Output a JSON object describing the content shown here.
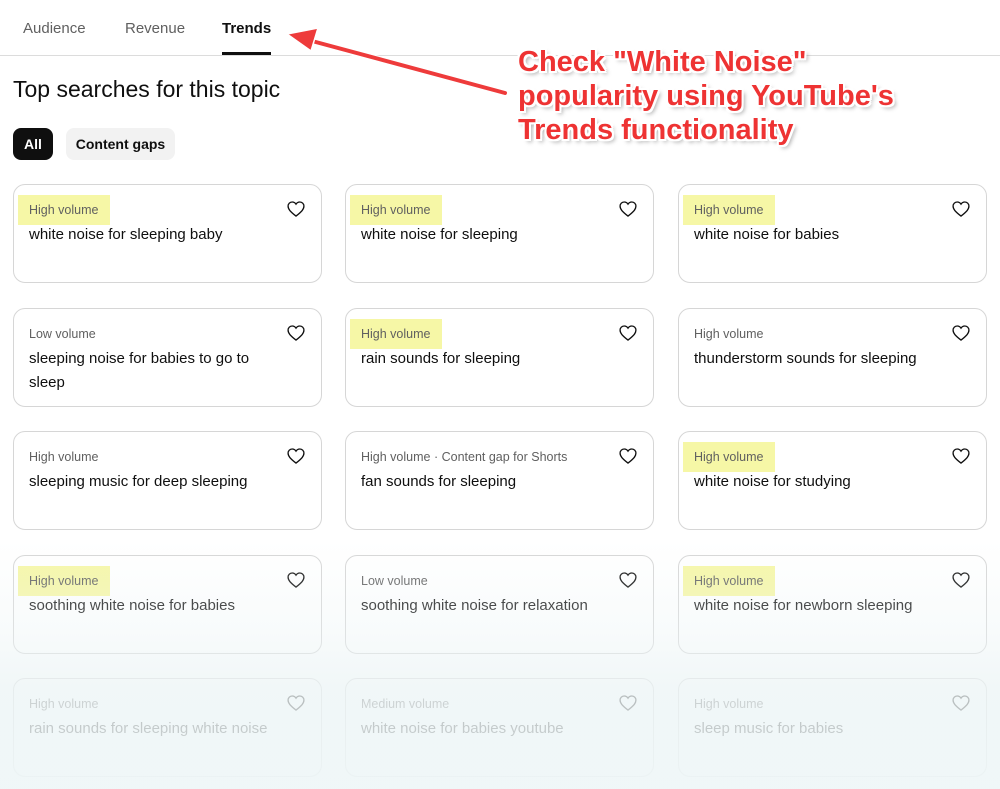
{
  "tabs": [
    {
      "label": "Audience"
    },
    {
      "label": "Revenue"
    },
    {
      "label": "Trends"
    }
  ],
  "page_title": "Top searches for this topic",
  "chips": {
    "all": "All",
    "content_gaps": "Content gaps"
  },
  "cards": [
    {
      "meta": "High volume",
      "query": "white noise for sleeping baby"
    },
    {
      "meta": "High volume",
      "query": "white noise for sleeping"
    },
    {
      "meta": "High volume",
      "query": "white noise for babies"
    },
    {
      "meta": "Low volume",
      "query": "sleeping noise for babies to go to sleep"
    },
    {
      "meta": "High volume",
      "query": "rain sounds for sleeping"
    },
    {
      "meta": "High volume",
      "query": "thunderstorm sounds for sleeping"
    },
    {
      "meta": "High volume",
      "query": "sleeping music for deep sleeping"
    },
    {
      "meta": "High volume · Content gap for Shorts",
      "query": "fan sounds for sleeping"
    },
    {
      "meta": "High volume",
      "query": "white noise for studying"
    },
    {
      "meta": "High volume",
      "query": "soothing white noise for babies"
    },
    {
      "meta": "Low volume",
      "query": "soothing white noise for relaxation"
    },
    {
      "meta": "High volume",
      "query": "white noise for newborn sleeping"
    },
    {
      "meta": "High volume",
      "query": "rain sounds for sleeping white noise"
    },
    {
      "meta": "Medium volume",
      "query": "white noise for babies youtube"
    },
    {
      "meta": "High volume",
      "query": "sleep music for babies"
    }
  ],
  "annotation": {
    "line1": "Check \"White Noise\"",
    "line2": "popularity using YouTube's",
    "line3": "Trends functionality"
  },
  "colors": {
    "highlight": "#f6f7a6",
    "annotation": "#ee3333",
    "active_tab": "#0f0f0f"
  }
}
